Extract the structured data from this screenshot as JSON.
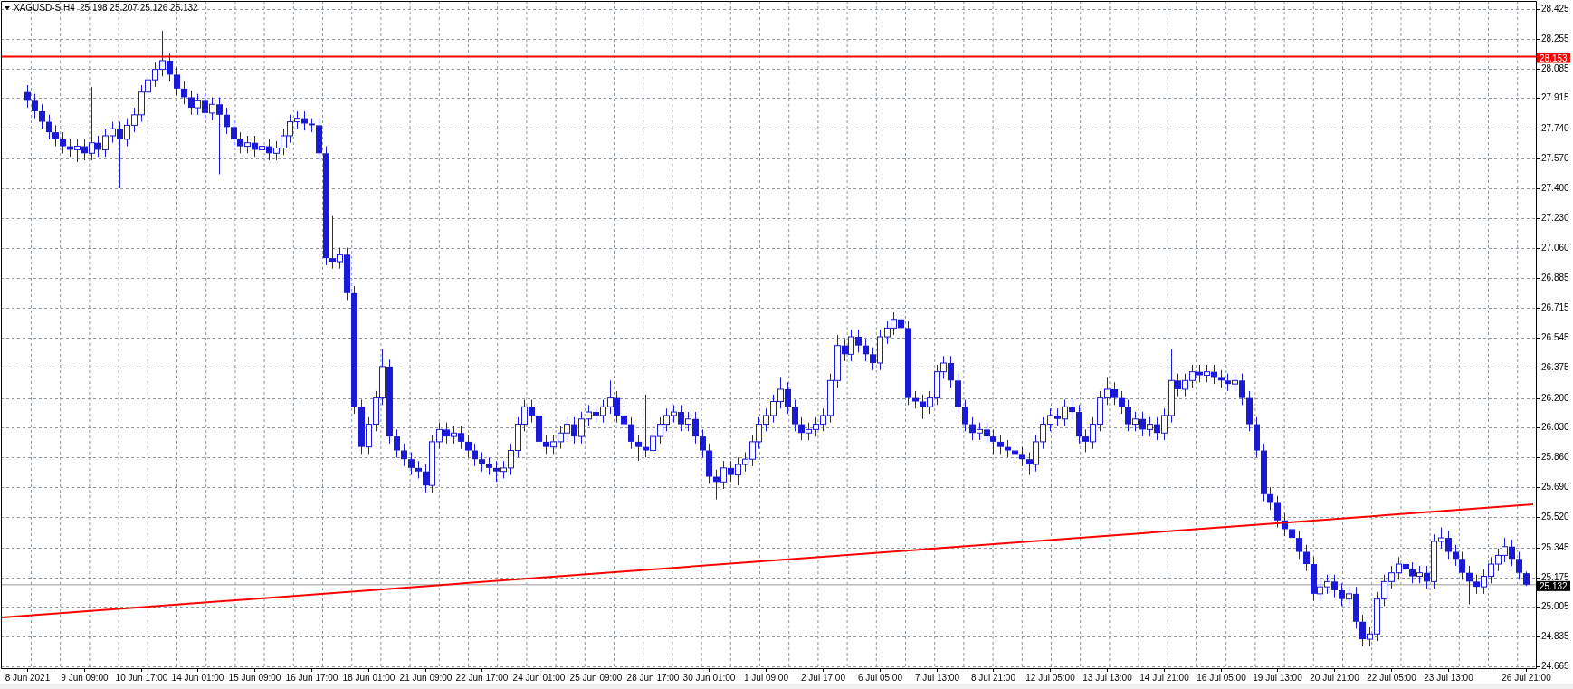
{
  "header": {
    "symbol": "XAGUSD-S,H4",
    "ohlc": "25.198 25.207 25.126 25.132"
  },
  "chart": {
    "chart_data": {
      "type": "candlestick",
      "grid": true,
      "ylim": [
        24.665,
        28.425
      ],
      "categories": [
        "8 Jun 2021",
        null,
        null,
        null,
        null,
        null,
        null,
        null,
        "9 Jun 09:00",
        null,
        null,
        null,
        null,
        null,
        null,
        null,
        "10 Jun 17:00",
        null,
        null,
        null,
        null,
        null,
        null,
        null,
        "14 Jun 01:00",
        null,
        null,
        null,
        null,
        null,
        null,
        null,
        "15 Jun 09:00",
        null,
        null,
        null,
        null,
        null,
        null,
        null,
        "16 Jun 17:00",
        null,
        null,
        null,
        null,
        null,
        null,
        null,
        "18 Jun 01:00",
        null,
        null,
        null,
        null,
        null,
        null,
        null,
        "21 Jun 09:00",
        null,
        null,
        null,
        null,
        null,
        null,
        null,
        "22 Jun 17:00",
        null,
        null,
        null,
        null,
        null,
        null,
        null,
        "24 Jun 01:00",
        null,
        null,
        null,
        null,
        null,
        null,
        null,
        "25 Jun 09:00",
        null,
        null,
        null,
        null,
        null,
        null,
        null,
        "28 Jun 17:00",
        null,
        null,
        null,
        null,
        null,
        null,
        null,
        "30 Jun 01:00",
        null,
        null,
        null,
        null,
        null,
        null,
        null,
        "1 Jul 09:00",
        null,
        null,
        null,
        null,
        null,
        null,
        null,
        "2 Jul 17:00",
        null,
        null,
        null,
        null,
        null,
        null,
        null,
        "6 Jul 05:00",
        null,
        null,
        null,
        null,
        null,
        null,
        null,
        "7 Jul 13:00",
        null,
        null,
        null,
        null,
        null,
        null,
        null,
        "8 Jul 21:00",
        null,
        null,
        null,
        null,
        null,
        null,
        null,
        "12 Jul 05:00",
        null,
        null,
        null,
        null,
        null,
        null,
        null,
        "13 Jul 13:00",
        null,
        null,
        null,
        null,
        null,
        null,
        null,
        "14 Jul 21:00",
        null,
        null,
        null,
        null,
        null,
        null,
        null,
        "16 Jul 05:00",
        null,
        null,
        null,
        null,
        null,
        null,
        null,
        "19 Jul 13:00",
        null,
        null,
        null,
        null,
        null,
        null,
        null,
        "20 Jul 21:00",
        null,
        null,
        null,
        null,
        null,
        null,
        null,
        "22 Jul 05:00",
        null,
        null,
        null,
        null,
        null,
        null,
        null,
        "23 Jul 13:00",
        null,
        null,
        null,
        null,
        null,
        null,
        null,
        null,
        null,
        null,
        "26 Jul 21:00"
      ],
      "ref_lines": [
        {
          "axis": "y",
          "value": 28.153,
          "color": "#ff0000",
          "label": "28.153"
        },
        {
          "axis": "y",
          "value": 25.132,
          "color": "#9a9a9a",
          "label": "25.132"
        }
      ],
      "yticks": [
        {
          "value": 28.425,
          "label": "28.425"
        },
        {
          "value": 28.255,
          "label": "28.255"
        },
        {
          "value": 28.085,
          "label": "28.085"
        },
        {
          "value": 27.915,
          "label": "27.915"
        },
        {
          "value": 27.74,
          "label": "27.740"
        },
        {
          "value": 27.57,
          "label": "27.570"
        },
        {
          "value": 27.4,
          "label": "27.400"
        },
        {
          "value": 27.23,
          "label": "27.230"
        },
        {
          "value": 27.06,
          "label": "27.060"
        },
        {
          "value": 26.885,
          "label": "26.885"
        },
        {
          "value": 26.715,
          "label": "26.715"
        },
        {
          "value": 26.545,
          "label": "26.545"
        },
        {
          "value": 26.375,
          "label": "26.375"
        },
        {
          "value": 26.2,
          "label": "26.200"
        },
        {
          "value": 26.03,
          "label": "26.030"
        },
        {
          "value": 25.86,
          "label": "25.860"
        },
        {
          "value": 25.69,
          "label": "25.690"
        },
        {
          "value": 25.52,
          "label": "25.520"
        },
        {
          "value": 25.345,
          "label": "25.345"
        },
        {
          "value": 25.175,
          "label": "25.175"
        },
        {
          "value": 25.005,
          "label": "25.005"
        },
        {
          "value": 24.835,
          "label": "24.835"
        },
        {
          "value": 24.665,
          "label": "24.665"
        }
      ],
      "ohlc": [
        [
          27.95,
          27.99,
          27.86,
          27.9
        ],
        [
          27.9,
          27.94,
          27.8,
          27.84
        ],
        [
          27.84,
          27.88,
          27.74,
          27.78
        ],
        [
          27.78,
          27.82,
          27.68,
          27.72
        ],
        [
          27.72,
          27.76,
          27.64,
          27.68
        ],
        [
          27.68,
          27.72,
          27.6,
          27.64
        ],
        [
          27.64,
          27.68,
          27.58,
          27.62
        ],
        [
          27.62,
          27.68,
          27.55,
          27.64
        ],
        [
          27.64,
          27.68,
          27.56,
          27.6
        ],
        [
          27.6,
          27.98,
          27.56,
          27.66
        ],
        [
          27.66,
          27.7,
          27.58,
          27.62
        ],
        [
          27.62,
          27.74,
          27.58,
          27.7
        ],
        [
          27.7,
          27.78,
          27.66,
          27.74
        ],
        [
          27.74,
          27.78,
          27.4,
          27.68
        ],
        [
          27.68,
          27.8,
          27.64,
          27.76
        ],
        [
          27.76,
          27.86,
          27.72,
          27.82
        ],
        [
          27.82,
          27.99,
          27.78,
          27.95
        ],
        [
          27.95,
          28.06,
          27.91,
          28.02
        ],
        [
          28.02,
          28.12,
          27.98,
          28.08
        ],
        [
          28.08,
          28.3,
          28.04,
          28.13
        ],
        [
          28.13,
          28.17,
          28.01,
          28.05
        ],
        [
          28.05,
          28.09,
          27.93,
          27.97
        ],
        [
          27.97,
          28.01,
          27.88,
          27.92
        ],
        [
          27.92,
          27.96,
          27.82,
          27.86
        ],
        [
          27.86,
          27.94,
          27.82,
          27.9
        ],
        [
          27.9,
          27.94,
          27.79,
          27.83
        ],
        [
          27.83,
          27.92,
          27.79,
          27.88
        ],
        [
          27.88,
          27.92,
          27.48,
          27.82
        ],
        [
          27.82,
          27.86,
          27.71,
          27.75
        ],
        [
          27.75,
          27.79,
          27.64,
          27.68
        ],
        [
          27.68,
          27.72,
          27.6,
          27.64
        ],
        [
          27.64,
          27.7,
          27.6,
          27.66
        ],
        [
          27.66,
          27.7,
          27.58,
          27.62
        ],
        [
          27.62,
          27.68,
          27.58,
          27.64
        ],
        [
          27.64,
          27.68,
          27.56,
          27.6
        ],
        [
          27.6,
          27.67,
          27.56,
          27.63
        ],
        [
          27.63,
          27.74,
          27.59,
          27.7
        ],
        [
          27.7,
          27.82,
          27.66,
          27.78
        ],
        [
          27.78,
          27.84,
          27.74,
          27.8
        ],
        [
          27.8,
          27.84,
          27.73,
          27.77
        ],
        [
          27.77,
          27.8,
          27.72,
          27.76
        ],
        [
          27.76,
          27.8,
          27.56,
          27.6
        ],
        [
          27.6,
          27.64,
          26.96,
          27.0
        ],
        [
          27.0,
          27.24,
          26.94,
          26.98
        ],
        [
          26.98,
          27.06,
          26.94,
          27.02
        ],
        [
          27.02,
          27.06,
          26.76,
          26.8
        ],
        [
          26.8,
          26.84,
          26.11,
          26.15
        ],
        [
          26.15,
          26.19,
          25.88,
          25.92
        ],
        [
          25.92,
          26.09,
          25.88,
          26.05
        ],
        [
          26.05,
          26.24,
          26.01,
          26.2
        ],
        [
          26.2,
          26.48,
          26.16,
          26.38
        ],
        [
          26.38,
          26.42,
          25.94,
          25.98
        ],
        [
          25.98,
          26.02,
          25.86,
          25.9
        ],
        [
          25.9,
          25.94,
          25.81,
          25.85
        ],
        [
          25.85,
          25.89,
          25.76,
          25.8
        ],
        [
          25.8,
          25.84,
          25.74,
          25.78
        ],
        [
          25.78,
          25.82,
          25.66,
          25.7
        ],
        [
          25.7,
          25.99,
          25.66,
          25.95
        ],
        [
          25.95,
          26.06,
          25.91,
          26.02
        ],
        [
          26.02,
          26.06,
          25.94,
          25.98
        ],
        [
          25.98,
          26.04,
          25.94,
          26.0
        ],
        [
          26.0,
          26.04,
          25.91,
          25.95
        ],
        [
          25.95,
          25.99,
          25.86,
          25.9
        ],
        [
          25.9,
          25.94,
          25.81,
          25.85
        ],
        [
          25.85,
          25.89,
          25.78,
          25.82
        ],
        [
          25.82,
          25.86,
          25.76,
          25.8
        ],
        [
          25.8,
          25.84,
          25.72,
          25.78
        ],
        [
          25.78,
          25.84,
          25.74,
          25.8
        ],
        [
          25.8,
          25.94,
          25.76,
          25.9
        ],
        [
          25.9,
          26.09,
          25.86,
          26.05
        ],
        [
          26.05,
          26.19,
          26.01,
          26.15
        ],
        [
          26.15,
          26.19,
          26.06,
          26.1
        ],
        [
          26.1,
          26.14,
          25.91,
          25.95
        ],
        [
          25.95,
          25.99,
          25.88,
          25.92
        ],
        [
          25.92,
          25.99,
          25.88,
          25.95
        ],
        [
          25.95,
          26.04,
          25.91,
          26.0
        ],
        [
          26.0,
          26.09,
          25.96,
          26.05
        ],
        [
          26.05,
          26.09,
          25.94,
          25.98
        ],
        [
          25.98,
          26.12,
          25.94,
          26.08
        ],
        [
          26.08,
          26.16,
          26.04,
          26.12
        ],
        [
          26.12,
          26.16,
          26.06,
          26.1
        ],
        [
          26.1,
          26.19,
          26.06,
          26.15
        ],
        [
          26.15,
          26.3,
          26.11,
          26.2
        ],
        [
          26.2,
          26.24,
          26.06,
          26.1
        ],
        [
          26.1,
          26.14,
          26.01,
          26.05
        ],
        [
          26.05,
          26.09,
          25.91,
          25.95
        ],
        [
          25.95,
          25.99,
          25.84,
          25.92
        ],
        [
          25.92,
          26.22,
          25.86,
          25.9
        ],
        [
          25.9,
          26.02,
          25.86,
          25.98
        ],
        [
          25.98,
          26.09,
          25.94,
          26.05
        ],
        [
          26.05,
          26.14,
          26.01,
          26.1
        ],
        [
          26.1,
          26.16,
          26.06,
          26.12
        ],
        [
          26.12,
          26.16,
          26.01,
          26.05
        ],
        [
          26.05,
          26.12,
          26.01,
          26.08
        ],
        [
          26.08,
          26.12,
          25.94,
          25.98
        ],
        [
          25.98,
          26.02,
          25.86,
          25.9
        ],
        [
          25.9,
          25.94,
          25.71,
          25.75
        ],
        [
          25.75,
          25.79,
          25.62,
          25.72
        ],
        [
          25.72,
          25.84,
          25.68,
          25.8
        ],
        [
          25.8,
          25.84,
          25.72,
          25.76
        ],
        [
          25.76,
          25.86,
          25.7,
          25.82
        ],
        [
          25.82,
          25.89,
          25.78,
          25.85
        ],
        [
          25.85,
          25.99,
          25.81,
          25.95
        ],
        [
          25.95,
          26.09,
          25.91,
          26.05
        ],
        [
          26.05,
          26.14,
          26.01,
          26.1
        ],
        [
          26.1,
          26.22,
          26.06,
          26.18
        ],
        [
          26.18,
          26.32,
          26.14,
          26.25
        ],
        [
          26.25,
          26.29,
          26.11,
          26.15
        ],
        [
          26.15,
          26.19,
          26.01,
          26.05
        ],
        [
          26.05,
          26.09,
          25.96,
          26.0
        ],
        [
          26.0,
          26.06,
          25.96,
          26.02
        ],
        [
          26.02,
          26.09,
          25.98,
          26.05
        ],
        [
          26.05,
          26.14,
          26.01,
          26.1
        ],
        [
          26.1,
          26.34,
          26.06,
          26.3
        ],
        [
          26.3,
          26.56,
          26.26,
          26.5
        ],
        [
          26.5,
          26.54,
          26.41,
          26.45
        ],
        [
          26.45,
          26.59,
          26.41,
          26.55
        ],
        [
          26.55,
          26.59,
          26.46,
          26.5
        ],
        [
          26.5,
          26.54,
          26.41,
          26.45
        ],
        [
          26.45,
          26.49,
          26.36,
          26.4
        ],
        [
          26.4,
          26.59,
          26.36,
          26.55
        ],
        [
          26.55,
          26.64,
          26.51,
          26.6
        ],
        [
          26.6,
          26.69,
          26.56,
          26.65
        ],
        [
          26.65,
          26.69,
          26.56,
          26.6
        ],
        [
          26.6,
          26.64,
          26.16,
          26.2
        ],
        [
          26.2,
          26.24,
          26.14,
          26.18
        ],
        [
          26.18,
          26.22,
          26.08,
          26.15
        ],
        [
          26.15,
          26.24,
          26.11,
          26.2
        ],
        [
          26.2,
          26.39,
          26.16,
          26.35
        ],
        [
          26.35,
          26.44,
          26.31,
          26.4
        ],
        [
          26.4,
          26.44,
          26.26,
          26.3
        ],
        [
          26.3,
          26.34,
          26.11,
          26.15
        ],
        [
          26.15,
          26.19,
          26.01,
          26.05
        ],
        [
          26.05,
          26.09,
          25.96,
          26.0
        ],
        [
          26.0,
          26.06,
          25.96,
          26.02
        ],
        [
          26.02,
          26.06,
          25.94,
          25.98
        ],
        [
          25.98,
          26.02,
          25.88,
          25.95
        ],
        [
          25.95,
          25.99,
          25.88,
          25.92
        ],
        [
          25.92,
          25.96,
          25.86,
          25.9
        ],
        [
          25.9,
          25.94,
          25.84,
          25.88
        ],
        [
          25.88,
          25.92,
          25.81,
          25.85
        ],
        [
          25.85,
          25.89,
          25.76,
          25.82
        ],
        [
          25.82,
          25.99,
          25.78,
          25.95
        ],
        [
          25.95,
          26.09,
          25.91,
          26.05
        ],
        [
          26.05,
          26.14,
          26.01,
          26.1
        ],
        [
          26.1,
          26.14,
          26.04,
          26.08
        ],
        [
          26.08,
          26.19,
          26.04,
          26.15
        ],
        [
          26.15,
          26.19,
          26.08,
          26.12
        ],
        [
          26.12,
          26.16,
          25.94,
          25.98
        ],
        [
          25.98,
          26.02,
          25.89,
          25.95
        ],
        [
          25.95,
          26.09,
          25.91,
          26.05
        ],
        [
          26.05,
          26.24,
          26.01,
          26.2
        ],
        [
          26.2,
          26.32,
          26.16,
          26.25
        ],
        [
          26.25,
          26.29,
          26.16,
          26.2
        ],
        [
          26.2,
          26.24,
          26.11,
          26.15
        ],
        [
          26.15,
          26.19,
          26.01,
          26.05
        ],
        [
          26.05,
          26.12,
          26.01,
          26.08
        ],
        [
          26.08,
          26.12,
          25.98,
          26.02
        ],
        [
          26.02,
          26.09,
          25.98,
          26.05
        ],
        [
          26.05,
          26.09,
          25.96,
          26.0
        ],
        [
          26.0,
          26.14,
          25.96,
          26.1
        ],
        [
          26.1,
          26.48,
          26.06,
          26.3
        ],
        [
          26.3,
          26.34,
          26.21,
          26.25
        ],
        [
          26.25,
          26.34,
          26.21,
          26.3
        ],
        [
          26.3,
          26.39,
          26.26,
          26.35
        ],
        [
          26.35,
          26.39,
          26.29,
          26.33
        ],
        [
          26.33,
          26.39,
          26.29,
          26.35
        ],
        [
          26.35,
          26.39,
          26.28,
          26.32
        ],
        [
          26.32,
          26.36,
          26.26,
          26.3
        ],
        [
          26.3,
          26.34,
          26.24,
          26.28
        ],
        [
          26.28,
          26.34,
          26.24,
          26.3
        ],
        [
          26.3,
          26.34,
          26.16,
          26.2
        ],
        [
          26.2,
          26.24,
          26.01,
          26.05
        ],
        [
          26.05,
          26.09,
          25.86,
          25.9
        ],
        [
          25.9,
          25.94,
          25.61,
          25.65
        ],
        [
          25.65,
          25.69,
          25.56,
          25.6
        ],
        [
          25.6,
          25.64,
          25.46,
          25.5
        ],
        [
          25.5,
          25.54,
          25.41,
          25.45
        ],
        [
          25.45,
          25.49,
          25.36,
          25.4
        ],
        [
          25.4,
          25.44,
          25.28,
          25.32
        ],
        [
          25.32,
          25.36,
          25.21,
          25.25
        ],
        [
          25.25,
          25.29,
          25.04,
          25.08
        ],
        [
          25.08,
          25.16,
          25.04,
          25.12
        ],
        [
          25.12,
          25.19,
          25.08,
          25.15
        ],
        [
          25.15,
          25.19,
          25.06,
          25.1
        ],
        [
          25.1,
          25.14,
          25.01,
          25.05
        ],
        [
          25.05,
          25.12,
          25.01,
          25.08
        ],
        [
          25.08,
          25.12,
          24.88,
          24.92
        ],
        [
          24.92,
          24.96,
          24.78,
          24.82
        ],
        [
          24.82,
          24.89,
          24.78,
          24.85
        ],
        [
          24.85,
          25.09,
          24.81,
          25.05
        ],
        [
          25.05,
          25.19,
          25.01,
          25.15
        ],
        [
          25.15,
          25.24,
          25.11,
          25.2
        ],
        [
          25.2,
          25.29,
          25.16,
          25.25
        ],
        [
          25.25,
          25.29,
          25.18,
          25.22
        ],
        [
          25.22,
          25.26,
          25.14,
          25.18
        ],
        [
          25.18,
          25.24,
          25.14,
          25.2
        ],
        [
          25.2,
          25.24,
          25.11,
          25.15
        ],
        [
          25.15,
          25.42,
          25.11,
          25.38
        ],
        [
          25.38,
          25.46,
          25.34,
          25.4
        ],
        [
          25.4,
          25.44,
          25.28,
          25.32
        ],
        [
          25.32,
          25.36,
          25.24,
          25.28
        ],
        [
          25.28,
          25.32,
          25.16,
          25.2
        ],
        [
          25.2,
          25.24,
          25.02,
          25.15
        ],
        [
          25.15,
          25.19,
          25.08,
          25.12
        ],
        [
          25.12,
          25.22,
          25.08,
          25.18
        ],
        [
          25.18,
          25.29,
          25.14,
          25.25
        ],
        [
          25.25,
          25.34,
          25.21,
          25.3
        ],
        [
          25.3,
          25.4,
          25.26,
          25.35
        ],
        [
          25.35,
          25.39,
          25.24,
          25.28
        ],
        [
          25.28,
          25.32,
          25.16,
          25.2
        ],
        [
          25.198,
          25.207,
          25.126,
          25.132
        ]
      ]
    }
  },
  "drawings": [
    {
      "kind": "trendline"
    }
  ]
}
